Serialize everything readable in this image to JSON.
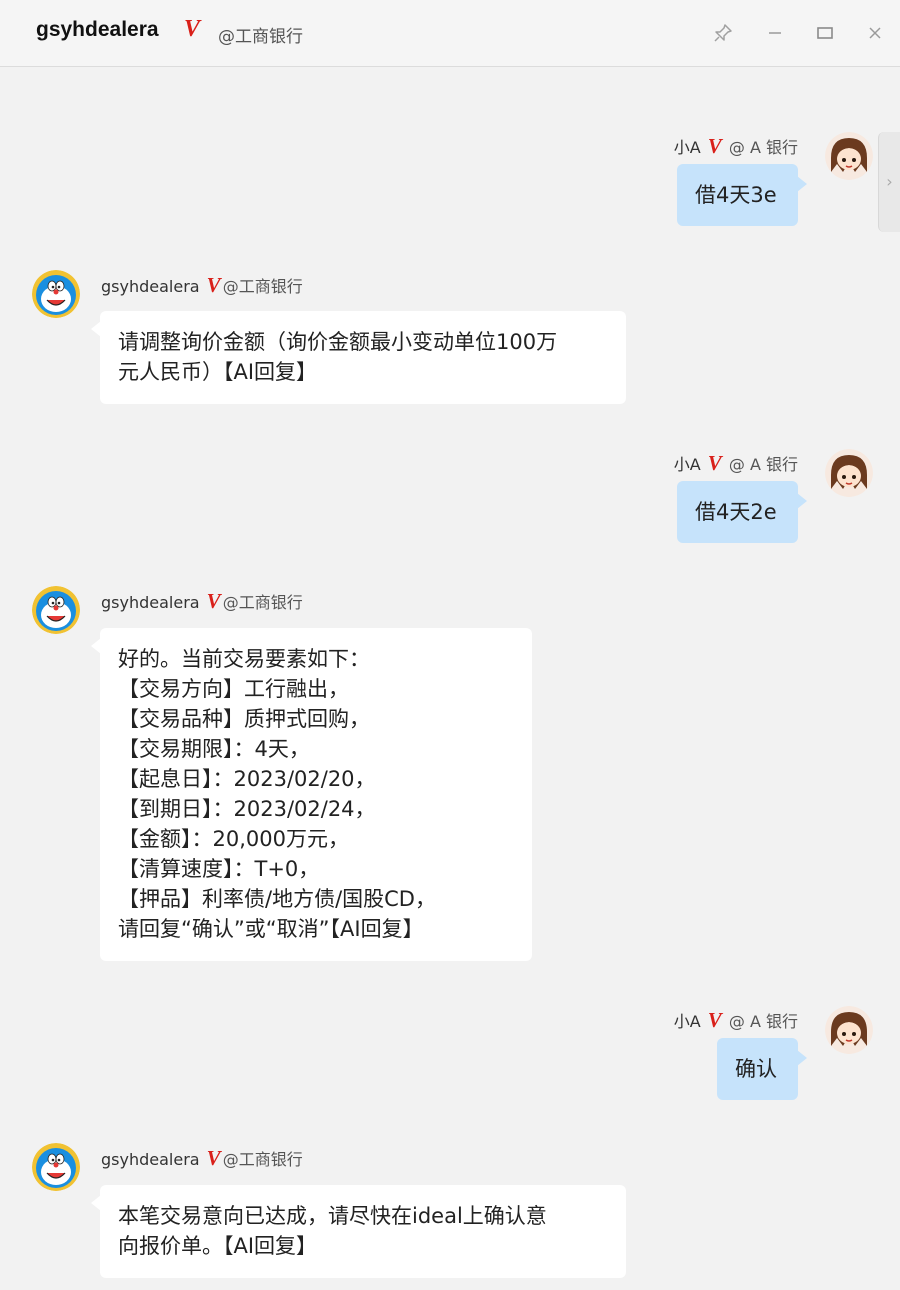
{
  "window": {
    "title_name": "gsyhdealera",
    "verified_mark": "V",
    "title_org": "@工商银行",
    "pin_icon": "pin-icon",
    "minimize_icon": "minimize-icon",
    "maximize_icon": "maximize-icon",
    "close_icon": "close-icon"
  },
  "messages": [
    {
      "side": "right",
      "sender": "小A",
      "mark": "V",
      "org": "@ A 银行",
      "text": "借4天3e"
    },
    {
      "side": "left",
      "sender": "gsyhdealera",
      "mark": "V",
      "org": "@工商银行",
      "text": "请调整询价金额（询价金额最小变动单位100万\n元人民币）【AI回复】"
    },
    {
      "side": "right",
      "sender": "小A",
      "mark": "V",
      "org": "@ A 银行",
      "text": "借4天2e"
    },
    {
      "side": "left",
      "sender": "gsyhdealera",
      "mark": "V",
      "org": "@工商银行",
      "text": "好的。当前交易要素如下：\n【交易方向】工行融出，\n【交易品种】质押式回购，\n【交易期限】：4天，\n【起息日】：2023/02/20，\n【到期日】：2023/02/24，\n【金额】：20,000万元，\n【清算速度】：T+0，\n【押品】利率债/地方债/国股CD，\n请回复“确认”或“取消”【AI回复】"
    },
    {
      "side": "right",
      "sender": "小A",
      "mark": "V",
      "org": "@ A 银行",
      "text": "确认"
    },
    {
      "side": "left",
      "sender": "gsyhdealera",
      "mark": "V",
      "org": "@工商银行",
      "text": "本笔交易意向已达成，请尽快在ideal上确认意\n向报价单。【AI回复】"
    }
  ]
}
